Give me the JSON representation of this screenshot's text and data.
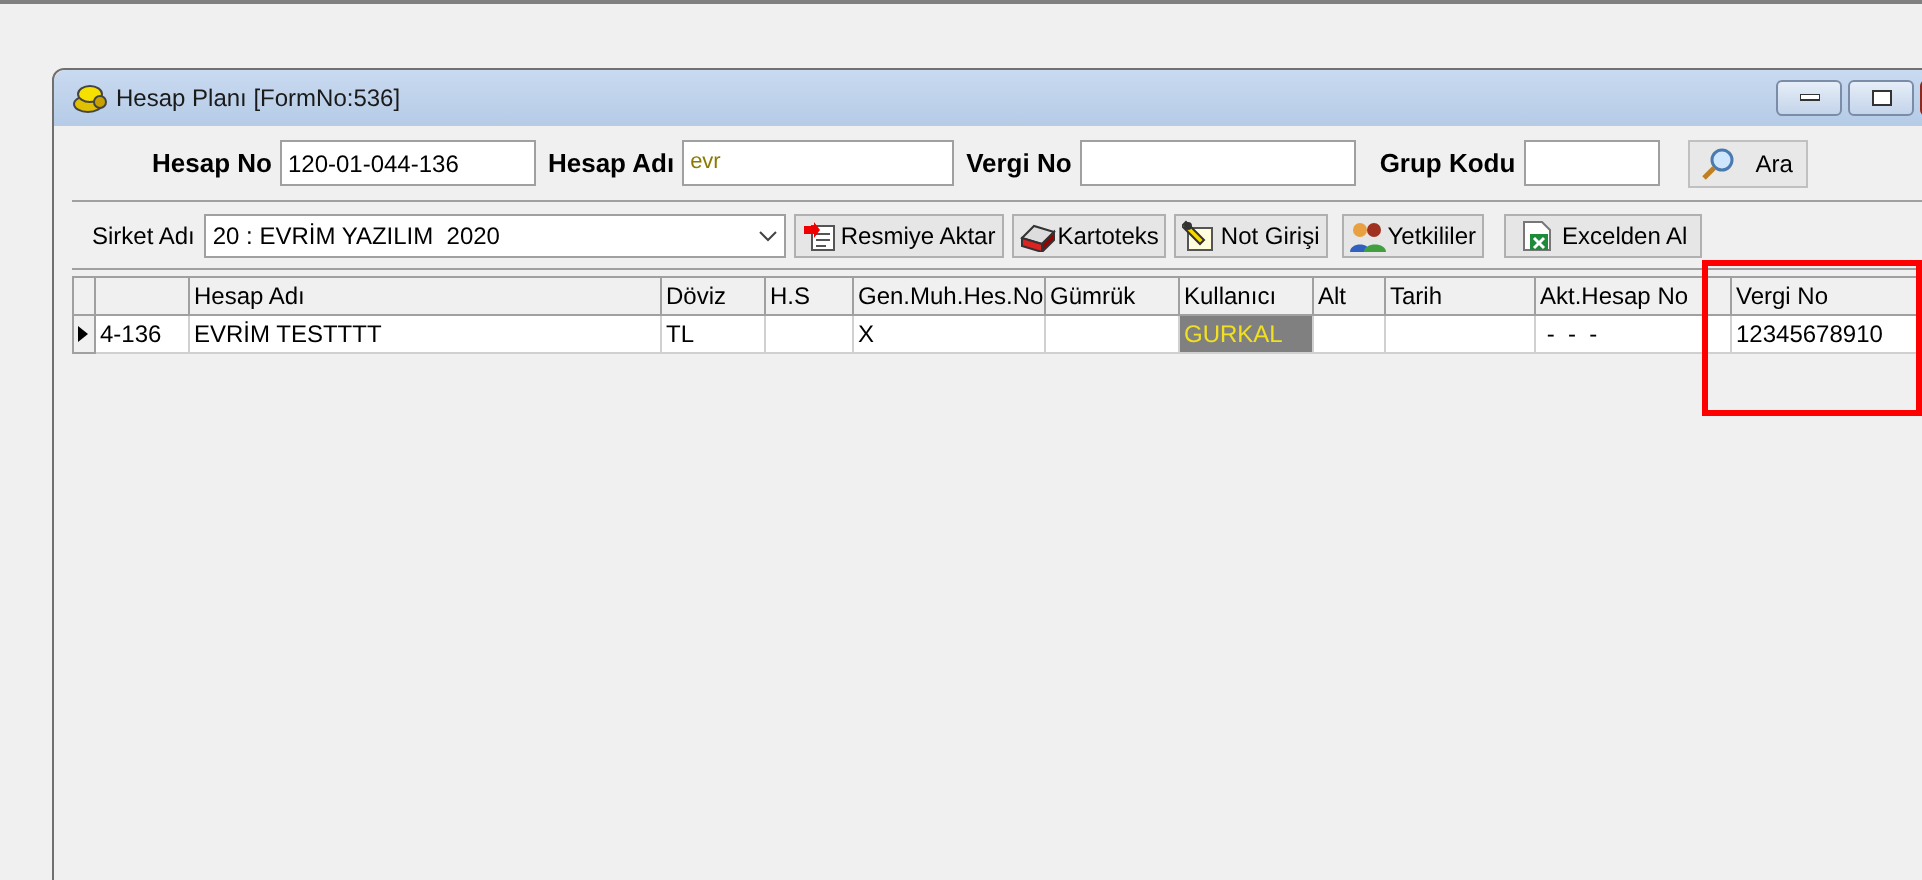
{
  "window": {
    "title": "Hesap Planı [FormNo:536]"
  },
  "filters": [
    {
      "label": "Hesap No",
      "value": "120-01-044-136"
    },
    {
      "label": "Hesap Adı",
      "value": "evr"
    },
    {
      "label": "Vergi No"
    },
    {
      "label": "Grup Kodu"
    }
  ],
  "search_button": "Ara",
  "company": {
    "label": "Sirket Adı",
    "value": "20 : EVRİM YAZILIM  2020"
  },
  "toolbar": [
    "Resmiye Aktar",
    "Kartoteks",
    "Not Girişi",
    "Yetkililer",
    "Excelden Al"
  ],
  "table": {
    "columns": [
      "",
      "Hesap Adı",
      "Döviz",
      "H.S",
      "Gen.Muh.Hes.No",
      "Gümrük",
      "Kullanıcı",
      "Alt",
      "Tarih",
      "Akt.Hesap No",
      "",
      "Vergi No"
    ],
    "rows": [
      {
        "current": true,
        "cells": [
          {
            "text": "4-136",
            "highlighted": false
          },
          {
            "text": "EVRİM TESTTTT",
            "highlighted": false
          },
          {
            "text": "TL",
            "highlighted": false
          },
          {
            "highlighted": false
          },
          {
            "text": "X",
            "highlighted": false
          },
          {
            "highlighted": false
          },
          {
            "text": "GURKAL",
            "highlighted": true
          },
          {
            "highlighted": false
          },
          {
            "highlighted": false
          },
          {
            "text": " -  -  -",
            "highlighted": false
          },
          {
            "highlighted": false
          },
          {
            "text": "12345678910",
            "highlighted": false
          }
        ]
      }
    ]
  },
  "annotation": {
    "kind": "highlight-box"
  }
}
